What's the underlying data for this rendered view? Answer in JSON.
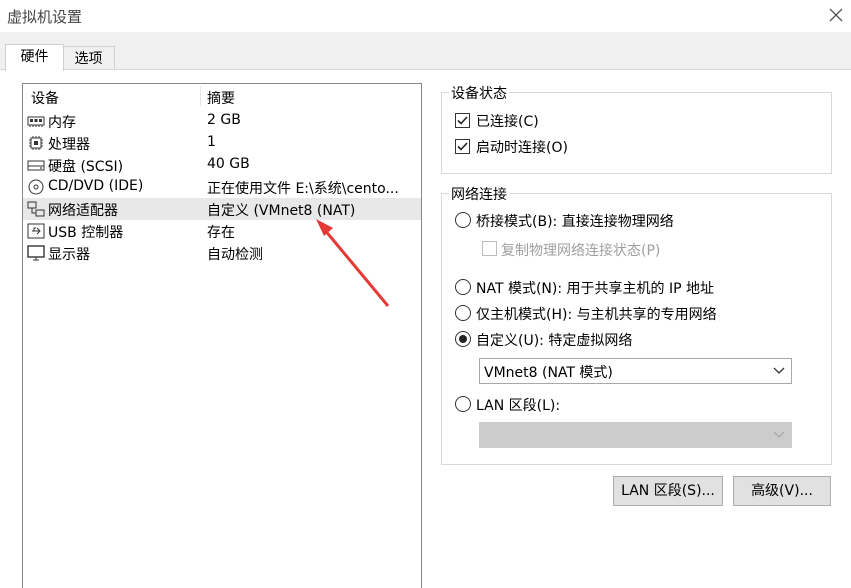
{
  "window": {
    "title": "虚拟机设置"
  },
  "tabs": [
    {
      "label": "硬件",
      "active": true
    },
    {
      "label": "选项",
      "active": false
    }
  ],
  "device_list": {
    "headers": {
      "device": "设备",
      "summary": "摘要"
    },
    "rows": [
      {
        "icon": "memory-icon",
        "name": "内存",
        "summary": "2 GB"
      },
      {
        "icon": "processor-icon",
        "name": "处理器",
        "summary": "1"
      },
      {
        "icon": "harddisk-icon",
        "name": "硬盘 (SCSI)",
        "summary": "40 GB"
      },
      {
        "icon": "cdrom-icon",
        "name": "CD/DVD (IDE)",
        "summary": "正在使用文件 E:\\系统\\cento..."
      },
      {
        "icon": "network-adapter-icon",
        "name": "网络适配器",
        "summary": "自定义 (VMnet8 (NAT)",
        "selected": true
      },
      {
        "icon": "usb-icon",
        "name": "USB 控制器",
        "summary": "存在"
      },
      {
        "icon": "display-icon",
        "name": "显示器",
        "summary": "自动检测"
      }
    ]
  },
  "device_status": {
    "label": "设备状态",
    "connected": {
      "label": "已连接(C)",
      "checked": true
    },
    "connect_on_power": {
      "label": "启动时连接(O)",
      "checked": true
    }
  },
  "network": {
    "label": "网络连接",
    "bridged": {
      "label": "桥接模式(B): 直接连接物理网络",
      "selected": false
    },
    "replicate": {
      "label": "复制物理网络连接状态(P)",
      "checked": false,
      "disabled": true
    },
    "nat": {
      "label": "NAT 模式(N): 用于共享主机的 IP 地址",
      "selected": false
    },
    "host_only": {
      "label": "仅主机模式(H): 与主机共享的专用网络",
      "selected": false
    },
    "custom": {
      "label": "自定义(U): 特定虚拟网络",
      "selected": true
    },
    "custom_select": {
      "value": "VMnet8 (NAT 模式)"
    },
    "lan_segment": {
      "label": "LAN 区段(L):",
      "selected": false
    },
    "lan_select": {
      "value": "",
      "disabled": true
    }
  },
  "buttons": {
    "lan_segments": "LAN 区段(S)...",
    "advanced": "高级(V)..."
  },
  "colors": {
    "annotation_arrow": "#e53935"
  }
}
